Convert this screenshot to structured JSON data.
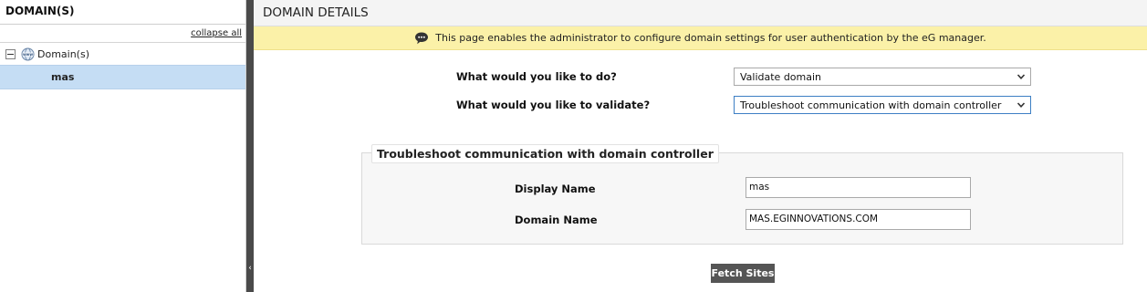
{
  "sidebar": {
    "title": "DOMAIN(S)",
    "collapse_all": "collapse all",
    "tree": {
      "root_label": "Domain(s)",
      "children": [
        "mas"
      ]
    }
  },
  "main": {
    "title": "DOMAIN DETAILS",
    "info_message": "This page enables the administrator to configure domain settings for user authentication by the eG manager.",
    "action_label": "What would you like to do?",
    "action_value": "Validate domain",
    "validate_label": "What would you like to validate?",
    "validate_value": "Troubleshoot communication with domain controller",
    "group": {
      "legend": "Troubleshoot communication with domain controller",
      "display_name_label": "Display Name",
      "display_name_value": "mas",
      "domain_name_label": "Domain Name",
      "domain_name_value": "MAS.EGINNOVATIONS.COM"
    },
    "fetch_button": "Fetch Sites"
  },
  "colors": {
    "info_bar": "#fbf1a8",
    "selected_item": "#c5ddf4",
    "splitter": "#4a4a4a",
    "button": "#555555"
  }
}
